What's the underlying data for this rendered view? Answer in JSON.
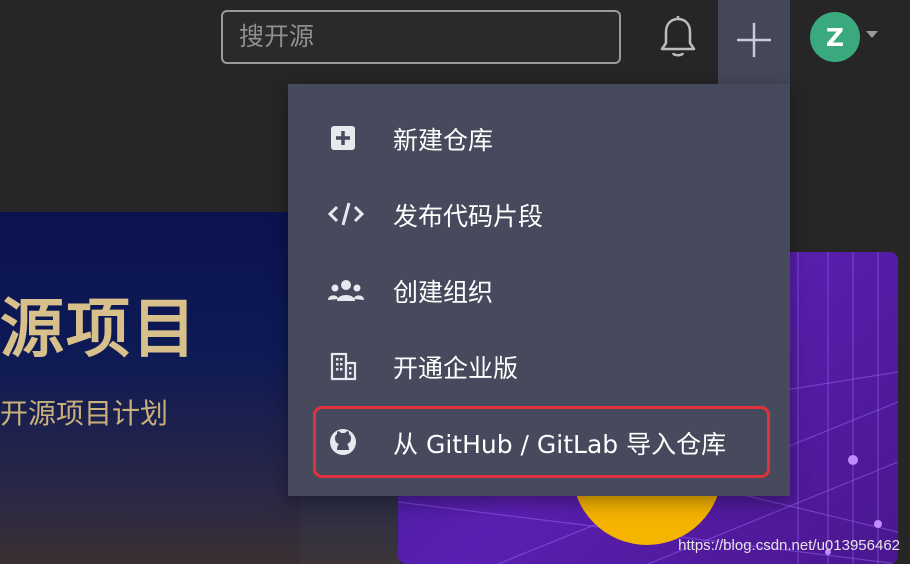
{
  "header": {
    "search": {
      "placeholder": "搜开源",
      "value": ""
    },
    "bell_icon": "bell-icon",
    "plus_icon": "plus-icon",
    "avatar_letter": "Z",
    "avatar_color": "#3aa97e"
  },
  "banner": {
    "title": "源项目",
    "subtitle": "开源项目计划"
  },
  "menu": {
    "items": [
      {
        "label": "新建仓库",
        "icon": "add-box-icon"
      },
      {
        "label": "发布代码片段",
        "icon": "code-icon"
      },
      {
        "label": "创建组织",
        "icon": "users-icon"
      },
      {
        "label": "开通企业版",
        "icon": "building-icon"
      },
      {
        "label": "从 GitHub / GitLab 导入仓库",
        "icon": "github-icon",
        "highlighted": true
      }
    ]
  },
  "watermark": "https://blog.csdn.net/u013956462",
  "colors": {
    "topbar_bg": "#262627",
    "menu_bg": "#464a5c",
    "highlight_border": "#e0323c"
  }
}
